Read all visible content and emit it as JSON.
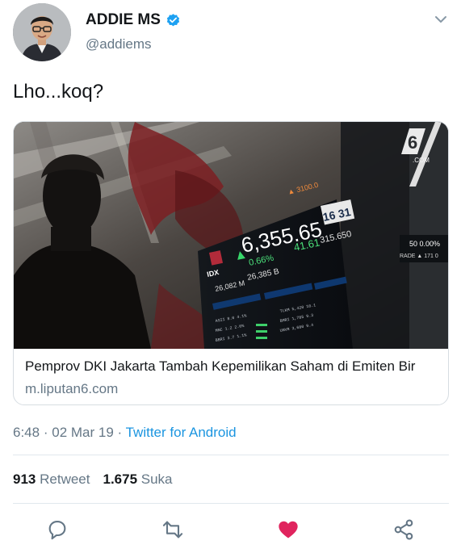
{
  "user": {
    "display_name": "ADDIE MS",
    "handle": "@addiems",
    "verified_icon": "verified-badge-icon",
    "accent_color": "#1da1f2"
  },
  "tweet": {
    "text": "Lho...koq?"
  },
  "link_card": {
    "image_overlay": {
      "brand_logo": "6",
      "brand_suffix": ".COM",
      "exchange_logo": "IDX",
      "index_value": "6,355.65",
      "index_change": "41.61",
      "index_percent": "0.66%",
      "board_time": "16 31",
      "side_panel_a": "50 0.00%",
      "side_panel_b": "RADE ▲ 171 0"
    },
    "title": "Pemprov DKI Jakarta Tambah Kepemilikan Saham di Emiten Bir",
    "domain": "m.liputan6.com"
  },
  "meta": {
    "time": "6:48",
    "date": "02 Mar 19",
    "separator": "·",
    "source": "Twitter for Android"
  },
  "stats": {
    "retweets_count": "913",
    "retweets_label": "Retweet",
    "likes_count": "1.675",
    "likes_label": "Suka"
  },
  "actions": [
    "reply-icon",
    "retweet-icon",
    "like-icon",
    "share-icon"
  ],
  "colors": {
    "text": "#14171a",
    "muted": "#657786",
    "link": "#1b95e0",
    "like": "#e0245e",
    "divider": "#e1e8ed"
  }
}
